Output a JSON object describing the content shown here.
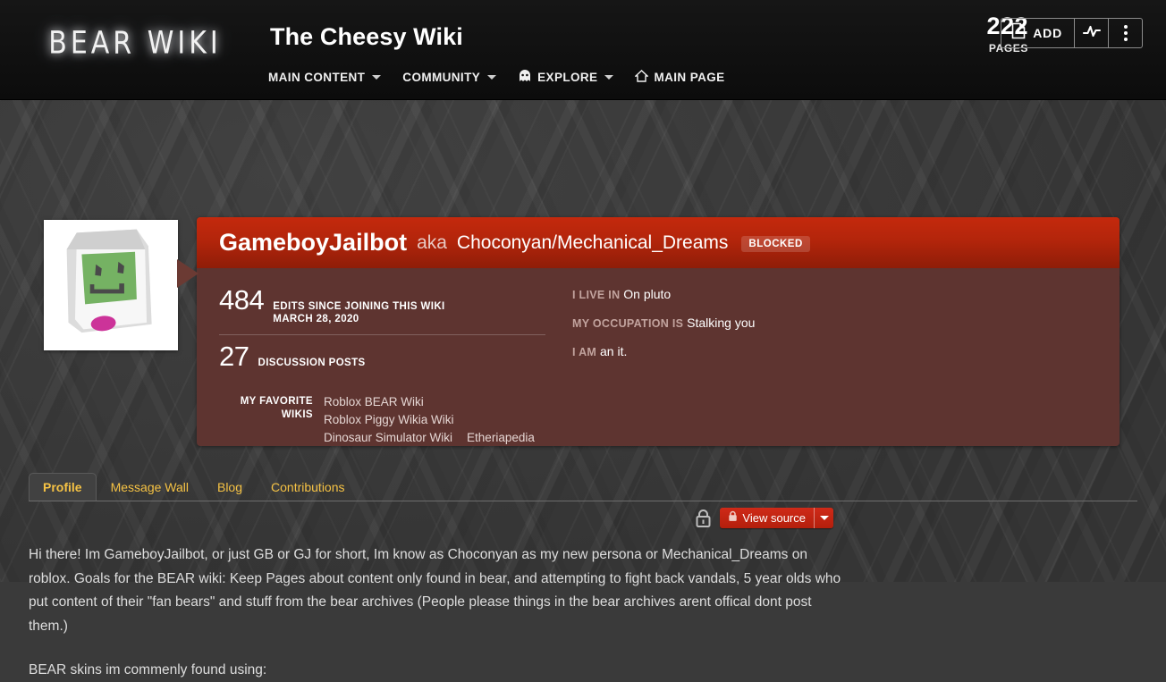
{
  "header": {
    "wordmark": "BEAR WIKI",
    "site_title": "The Cheesy Wiki",
    "nav": [
      {
        "label": "MAIN CONTENT",
        "icon": "",
        "caret": true
      },
      {
        "label": "COMMUNITY",
        "icon": "",
        "caret": true
      },
      {
        "label": "EXPLORE",
        "icon": "ghost-icon",
        "caret": true
      },
      {
        "label": "MAIN PAGE",
        "icon": "home-icon",
        "caret": false
      }
    ],
    "pages_count": "222",
    "pages_label": "PAGES",
    "add_label": "ADD",
    "add_icon": "page-icon",
    "activity_icon": "pulse-icon",
    "more_icon": "three-dots-icon"
  },
  "profile": {
    "avatar_alt": "gameboy-avatar",
    "username": "GameboyJailbot",
    "aka_word": "aka",
    "alias": "Choconyan/Mechanical_Dreams",
    "blocked_badge": "BLOCKED",
    "edits_count": "484",
    "edits_label_line1": "EDITS SINCE JOINING THIS WIKI",
    "edits_label_line2": "MARCH 28, 2020",
    "posts_count": "27",
    "posts_label": "DISCUSSION POSTS",
    "favorite_label_line1": "MY FAVORITE",
    "favorite_label_line2": "WIKIS",
    "favorite_wikis": [
      "Roblox BEAR Wiki",
      "Roblox Piggy Wikia Wiki",
      "Dinosaur Simulator Wiki",
      "Etheriapedia"
    ],
    "bio": [
      {
        "key": "I LIVE IN",
        "value": "On pluto"
      },
      {
        "key": "MY OCCUPATION IS",
        "value": "Stalking you"
      },
      {
        "key": "I AM",
        "value": "an it."
      }
    ]
  },
  "tabs": [
    {
      "label": "Profile",
      "active": true
    },
    {
      "label": "Message Wall",
      "active": false
    },
    {
      "label": "Blog",
      "active": false
    },
    {
      "label": "Contributions",
      "active": false
    }
  ],
  "actions": {
    "lock_icon": "padlock-icon",
    "view_source_label": "View source",
    "view_source_lock_icon": "small-lock-icon",
    "dropdown_icon": "caret-down-icon"
  },
  "article": {
    "paragraph1": "Hi there! Im GameboyJailbot, or just GB or GJ for short, Im know as Choconyan as my new persona or Mechanical_Dreams on roblox. Goals for the BEAR wiki: Keep Pages about content only found in bear, and attempting to fight back vandals, 5 year olds who put content of their \"fan bears\" and stuff from the bear archives (People please things in the bear archives arent offical dont post them.)",
    "paragraph2": "BEAR skins im commenly found using:"
  },
  "colors": {
    "accent_red": "#b3250b",
    "card_body": "#5e3430",
    "tab_gold": "#f5c244",
    "background": "#3b3b3b"
  }
}
